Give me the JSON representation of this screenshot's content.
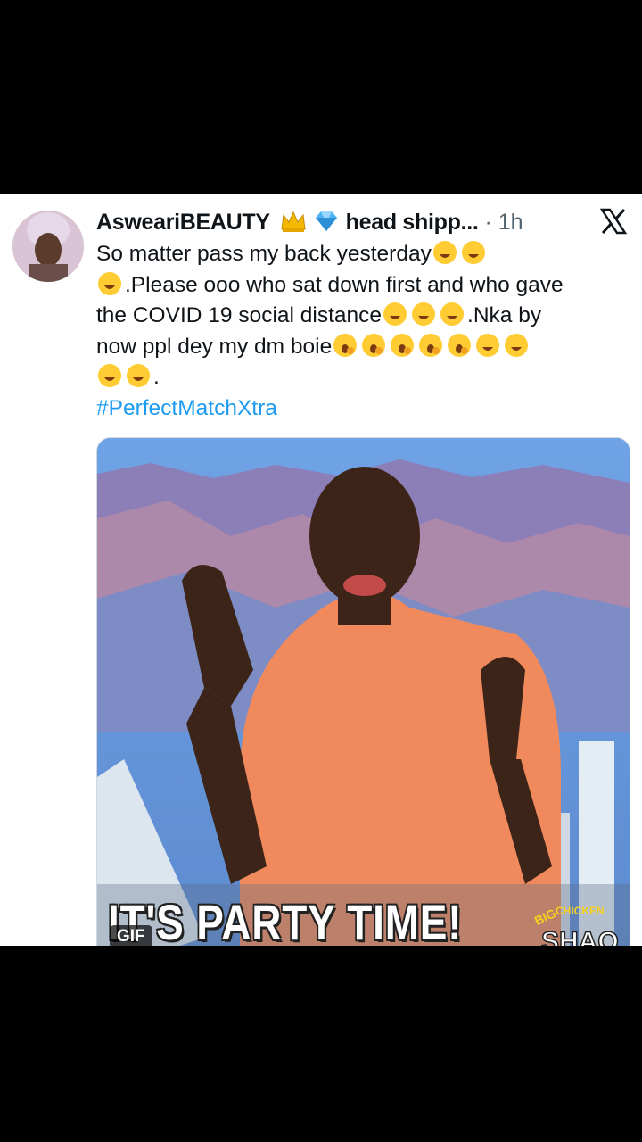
{
  "tweet": {
    "author_name": "AsweariBEAUTY",
    "author_suffix": "head shipp...",
    "separator": "·",
    "time": "1h",
    "text_line1": "So matter pass my back yesterday",
    "text_line2": ".Please ooo who sat down first and who gave",
    "text_line3": "the COVID 19 social distance",
    "text_line3b": ".Nka by",
    "text_line4": "now ppl dey my dm boie",
    "text_line5": ".",
    "hashtag": "#PerfectMatchXtra"
  },
  "media": {
    "caption": "IT'S PARTY TIME!",
    "gif_label": "GIF",
    "logo_top": "BIG CHICKEN",
    "logo_bottom": "SHAQ"
  },
  "icons": {
    "crown": "crown-emoji",
    "diamond": "gem-emoji",
    "laugh": "rofl-emoji",
    "yawn": "yawning-emoji",
    "platform": "x-logo-icon"
  },
  "colors": {
    "link": "#1d9bf0",
    "text": "#0f1419",
    "muted": "#536471",
    "shirt": "#f08a5d"
  }
}
